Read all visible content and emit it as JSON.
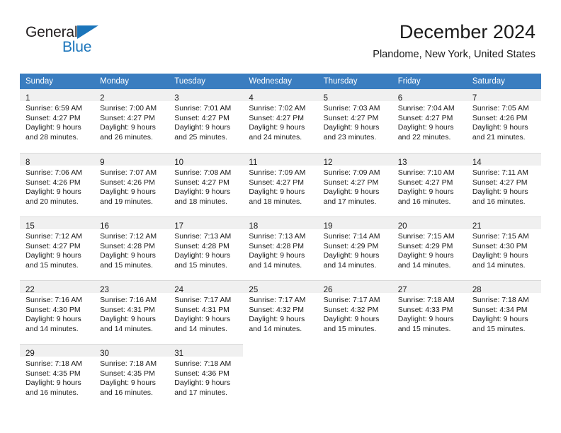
{
  "brand": {
    "name_part1": "General",
    "name_part2": "Blue",
    "color_primary": "#1b75bb",
    "color_text": "#231f20",
    "triangle_icon": "triangle-right-icon"
  },
  "header": {
    "title": "December 2024",
    "subtitle": "Plandome, New York, United States"
  },
  "theme": {
    "header_bg": "#3a7dc0",
    "header_fg": "#ffffff",
    "daynum_bg": "#f0f0f0",
    "grid_line": "#d9d9d9",
    "body_bg": "#ffffff",
    "text": "#1a1a1a"
  },
  "calendar": {
    "weekday_headers": [
      "Sunday",
      "Monday",
      "Tuesday",
      "Wednesday",
      "Thursday",
      "Friday",
      "Saturday"
    ],
    "weeks": [
      [
        {
          "day": "1",
          "sunrise": "Sunrise: 6:59 AM",
          "sunset": "Sunset: 4:27 PM",
          "daylight_line1": "Daylight: 9 hours",
          "daylight_line2": "and 28 minutes."
        },
        {
          "day": "2",
          "sunrise": "Sunrise: 7:00 AM",
          "sunset": "Sunset: 4:27 PM",
          "daylight_line1": "Daylight: 9 hours",
          "daylight_line2": "and 26 minutes."
        },
        {
          "day": "3",
          "sunrise": "Sunrise: 7:01 AM",
          "sunset": "Sunset: 4:27 PM",
          "daylight_line1": "Daylight: 9 hours",
          "daylight_line2": "and 25 minutes."
        },
        {
          "day": "4",
          "sunrise": "Sunrise: 7:02 AM",
          "sunset": "Sunset: 4:27 PM",
          "daylight_line1": "Daylight: 9 hours",
          "daylight_line2": "and 24 minutes."
        },
        {
          "day": "5",
          "sunrise": "Sunrise: 7:03 AM",
          "sunset": "Sunset: 4:27 PM",
          "daylight_line1": "Daylight: 9 hours",
          "daylight_line2": "and 23 minutes."
        },
        {
          "day": "6",
          "sunrise": "Sunrise: 7:04 AM",
          "sunset": "Sunset: 4:27 PM",
          "daylight_line1": "Daylight: 9 hours",
          "daylight_line2": "and 22 minutes."
        },
        {
          "day": "7",
          "sunrise": "Sunrise: 7:05 AM",
          "sunset": "Sunset: 4:26 PM",
          "daylight_line1": "Daylight: 9 hours",
          "daylight_line2": "and 21 minutes."
        }
      ],
      [
        {
          "day": "8",
          "sunrise": "Sunrise: 7:06 AM",
          "sunset": "Sunset: 4:26 PM",
          "daylight_line1": "Daylight: 9 hours",
          "daylight_line2": "and 20 minutes."
        },
        {
          "day": "9",
          "sunrise": "Sunrise: 7:07 AM",
          "sunset": "Sunset: 4:26 PM",
          "daylight_line1": "Daylight: 9 hours",
          "daylight_line2": "and 19 minutes."
        },
        {
          "day": "10",
          "sunrise": "Sunrise: 7:08 AM",
          "sunset": "Sunset: 4:27 PM",
          "daylight_line1": "Daylight: 9 hours",
          "daylight_line2": "and 18 minutes."
        },
        {
          "day": "11",
          "sunrise": "Sunrise: 7:09 AM",
          "sunset": "Sunset: 4:27 PM",
          "daylight_line1": "Daylight: 9 hours",
          "daylight_line2": "and 18 minutes."
        },
        {
          "day": "12",
          "sunrise": "Sunrise: 7:09 AM",
          "sunset": "Sunset: 4:27 PM",
          "daylight_line1": "Daylight: 9 hours",
          "daylight_line2": "and 17 minutes."
        },
        {
          "day": "13",
          "sunrise": "Sunrise: 7:10 AM",
          "sunset": "Sunset: 4:27 PM",
          "daylight_line1": "Daylight: 9 hours",
          "daylight_line2": "and 16 minutes."
        },
        {
          "day": "14",
          "sunrise": "Sunrise: 7:11 AM",
          "sunset": "Sunset: 4:27 PM",
          "daylight_line1": "Daylight: 9 hours",
          "daylight_line2": "and 16 minutes."
        }
      ],
      [
        {
          "day": "15",
          "sunrise": "Sunrise: 7:12 AM",
          "sunset": "Sunset: 4:27 PM",
          "daylight_line1": "Daylight: 9 hours",
          "daylight_line2": "and 15 minutes."
        },
        {
          "day": "16",
          "sunrise": "Sunrise: 7:12 AM",
          "sunset": "Sunset: 4:28 PM",
          "daylight_line1": "Daylight: 9 hours",
          "daylight_line2": "and 15 minutes."
        },
        {
          "day": "17",
          "sunrise": "Sunrise: 7:13 AM",
          "sunset": "Sunset: 4:28 PM",
          "daylight_line1": "Daylight: 9 hours",
          "daylight_line2": "and 15 minutes."
        },
        {
          "day": "18",
          "sunrise": "Sunrise: 7:13 AM",
          "sunset": "Sunset: 4:28 PM",
          "daylight_line1": "Daylight: 9 hours",
          "daylight_line2": "and 14 minutes."
        },
        {
          "day": "19",
          "sunrise": "Sunrise: 7:14 AM",
          "sunset": "Sunset: 4:29 PM",
          "daylight_line1": "Daylight: 9 hours",
          "daylight_line2": "and 14 minutes."
        },
        {
          "day": "20",
          "sunrise": "Sunrise: 7:15 AM",
          "sunset": "Sunset: 4:29 PM",
          "daylight_line1": "Daylight: 9 hours",
          "daylight_line2": "and 14 minutes."
        },
        {
          "day": "21",
          "sunrise": "Sunrise: 7:15 AM",
          "sunset": "Sunset: 4:30 PM",
          "daylight_line1": "Daylight: 9 hours",
          "daylight_line2": "and 14 minutes."
        }
      ],
      [
        {
          "day": "22",
          "sunrise": "Sunrise: 7:16 AM",
          "sunset": "Sunset: 4:30 PM",
          "daylight_line1": "Daylight: 9 hours",
          "daylight_line2": "and 14 minutes."
        },
        {
          "day": "23",
          "sunrise": "Sunrise: 7:16 AM",
          "sunset": "Sunset: 4:31 PM",
          "daylight_line1": "Daylight: 9 hours",
          "daylight_line2": "and 14 minutes."
        },
        {
          "day": "24",
          "sunrise": "Sunrise: 7:17 AM",
          "sunset": "Sunset: 4:31 PM",
          "daylight_line1": "Daylight: 9 hours",
          "daylight_line2": "and 14 minutes."
        },
        {
          "day": "25",
          "sunrise": "Sunrise: 7:17 AM",
          "sunset": "Sunset: 4:32 PM",
          "daylight_line1": "Daylight: 9 hours",
          "daylight_line2": "and 14 minutes."
        },
        {
          "day": "26",
          "sunrise": "Sunrise: 7:17 AM",
          "sunset": "Sunset: 4:32 PM",
          "daylight_line1": "Daylight: 9 hours",
          "daylight_line2": "and 15 minutes."
        },
        {
          "day": "27",
          "sunrise": "Sunrise: 7:18 AM",
          "sunset": "Sunset: 4:33 PM",
          "daylight_line1": "Daylight: 9 hours",
          "daylight_line2": "and 15 minutes."
        },
        {
          "day": "28",
          "sunrise": "Sunrise: 7:18 AM",
          "sunset": "Sunset: 4:34 PM",
          "daylight_line1": "Daylight: 9 hours",
          "daylight_line2": "and 15 minutes."
        }
      ],
      [
        {
          "day": "29",
          "sunrise": "Sunrise: 7:18 AM",
          "sunset": "Sunset: 4:35 PM",
          "daylight_line1": "Daylight: 9 hours",
          "daylight_line2": "and 16 minutes."
        },
        {
          "day": "30",
          "sunrise": "Sunrise: 7:18 AM",
          "sunset": "Sunset: 4:35 PM",
          "daylight_line1": "Daylight: 9 hours",
          "daylight_line2": "and 16 minutes."
        },
        {
          "day": "31",
          "sunrise": "Sunrise: 7:18 AM",
          "sunset": "Sunset: 4:36 PM",
          "daylight_line1": "Daylight: 9 hours",
          "daylight_line2": "and 17 minutes."
        },
        null,
        null,
        null,
        null
      ]
    ]
  }
}
